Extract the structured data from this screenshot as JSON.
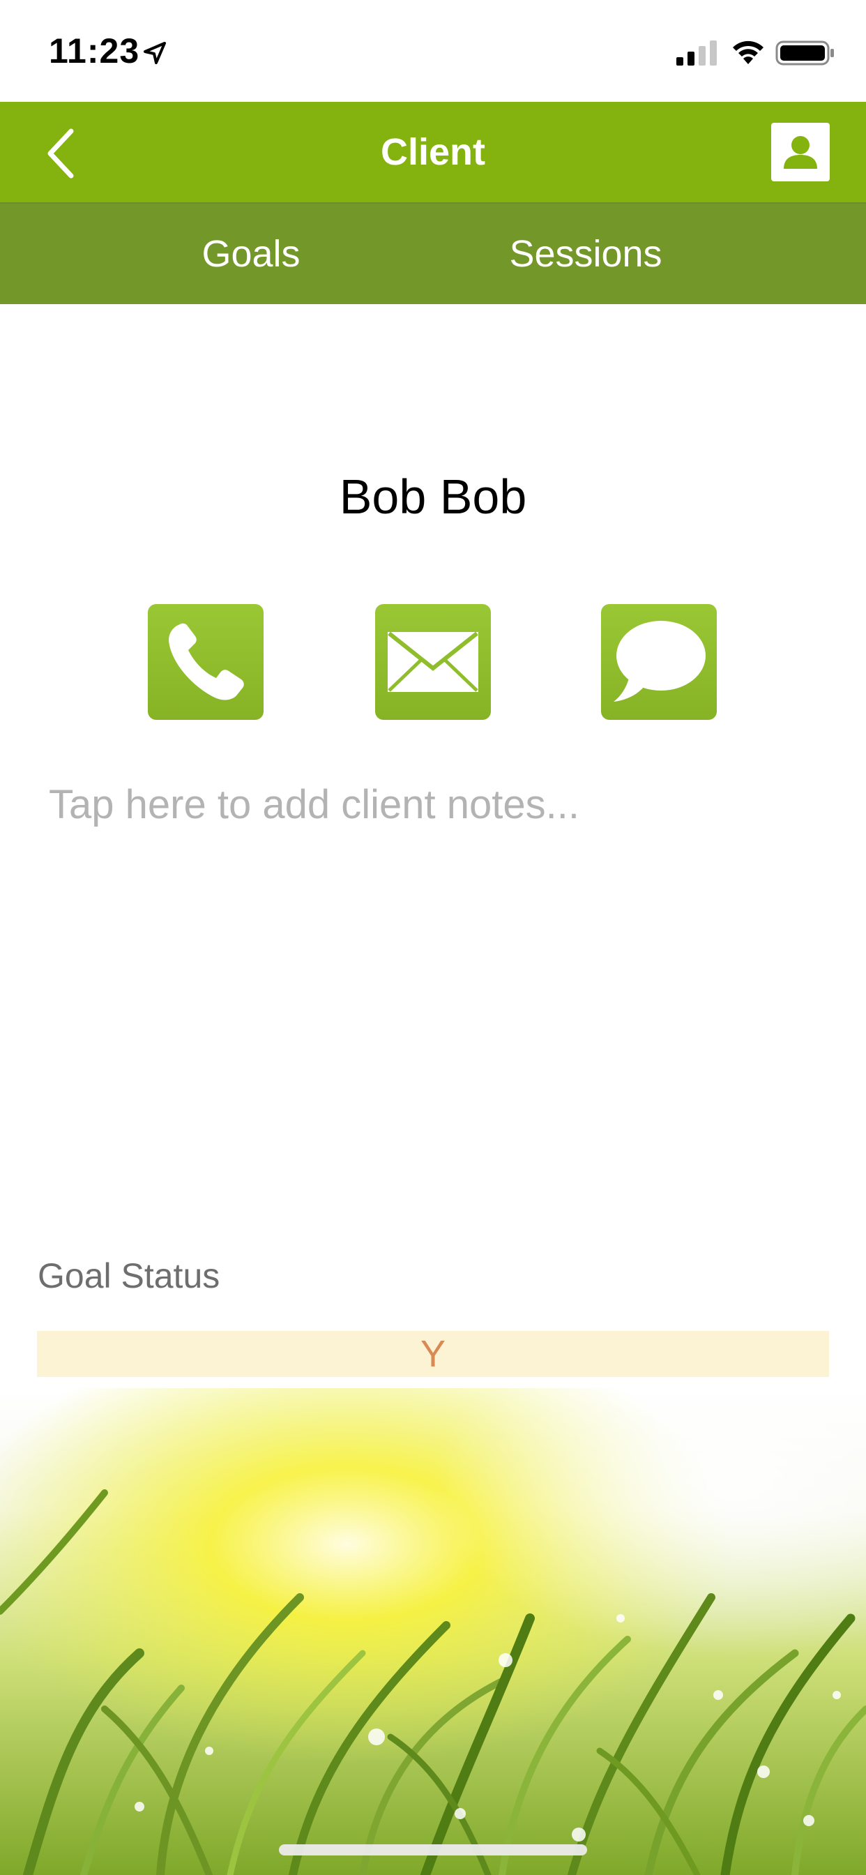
{
  "status_bar": {
    "time": "11:23"
  },
  "nav": {
    "title": "Client",
    "back_icon": "chevron-left-icon",
    "profile_icon": "person-icon"
  },
  "tabs": [
    {
      "label": "Goals"
    },
    {
      "label": "Sessions"
    }
  ],
  "client": {
    "name": "Bob Bob"
  },
  "actions": [
    {
      "icon": "phone-icon"
    },
    {
      "icon": "envelope-icon"
    },
    {
      "icon": "speech-bubble-icon"
    }
  ],
  "notes": {
    "placeholder": "Tap here to add client notes..."
  },
  "goal_status": {
    "label": "Goal Status",
    "value": "Y"
  },
  "colors": {
    "nav_green": "#84b30f",
    "tab_green": "#74972a",
    "action_green": "#8fbd2c",
    "goal_bar_bg": "#fcf2d4",
    "goal_value": "#d88a55"
  }
}
